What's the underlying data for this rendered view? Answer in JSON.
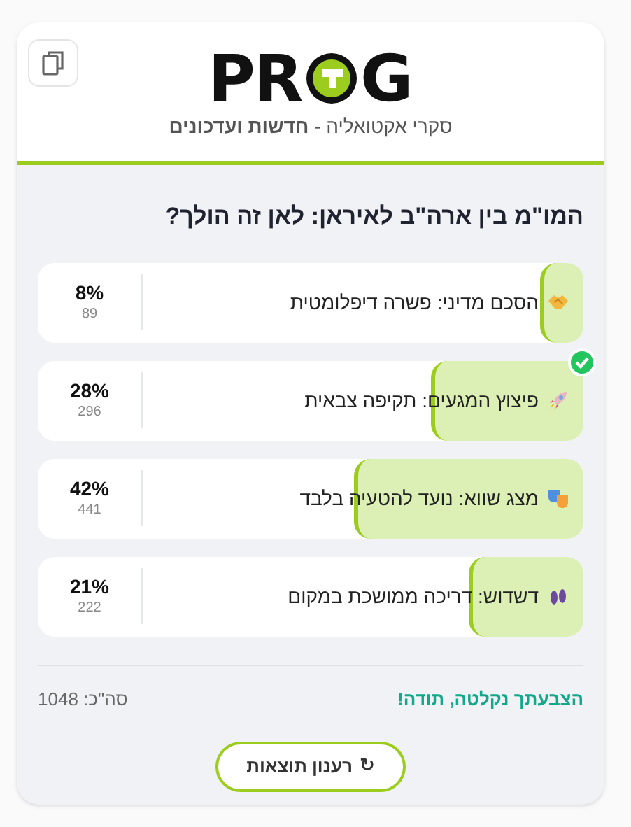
{
  "header": {
    "logo": {
      "left": "PR",
      "right": "G"
    },
    "tagline": "סקרי אקטואליה - **חדשות ועדכונים**"
  },
  "question": "המו\"מ בין ארה\"ב לאיראן: לאן זה הולך?",
  "options": [
    {
      "label": "הסכם מדיני: פשרה דיפלומטית",
      "percent": "8%",
      "votes": "89",
      "level": 0.08,
      "selected": false
    },
    {
      "label": "פיצוץ המגעים: תקיפה צבאית",
      "percent": "28%",
      "votes": "296",
      "level": 0.28,
      "selected": true
    },
    {
      "label": "מצג שווא: נועד להטעיה בלבד",
      "percent": "42%",
      "votes": "441",
      "level": 0.42,
      "selected": false
    },
    {
      "label": "דשדוש: דריכה ממושכת במקום",
      "percent": "21%",
      "votes": "222",
      "level": 0.21,
      "selected": false
    }
  ],
  "footer": {
    "message": "הצבעתך נקלטה, תודה!",
    "total": "סה\"כ: 1048"
  },
  "refresh_button": {
    "icon": "↻",
    "label": "רענון תוצאות"
  }
}
